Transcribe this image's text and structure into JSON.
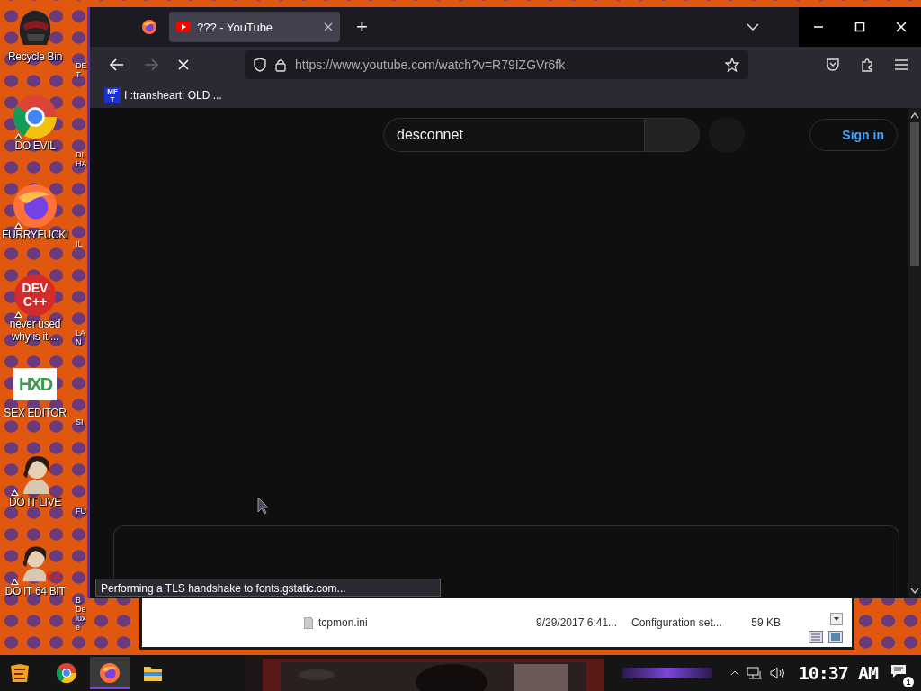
{
  "desktop_icons": [
    {
      "kind": "bin",
      "label": "Recycle Bin",
      "shortcut": false
    },
    {
      "kind": "chrome",
      "label": "DO EVIL",
      "shortcut": true
    },
    {
      "kind": "firefox",
      "label": "FURRYFUCK!",
      "shortcut": true
    },
    {
      "kind": "devcpp",
      "label": "never used why is it ...",
      "icon_text": "DEV C++",
      "shortcut": true
    },
    {
      "kind": "hxd",
      "label": "SEX EDITOR",
      "icon_text": "HXD",
      "shortcut": false
    },
    {
      "kind": "portrait",
      "label": "DO IT LIVE",
      "shortcut": true
    },
    {
      "kind": "portrait",
      "label": "DO IT 64 BIT",
      "icon_text": "64",
      "shortcut": true
    }
  ],
  "desktop_icons_column_2": [
    "DET",
    "DI HA",
    "IL",
    "LAN",
    "SI",
    "FU",
    "B Deluxe"
  ],
  "explorer": {
    "rows": [
      {
        "name": "tcpmon.ini",
        "date": "9/29/2017 6:41...",
        "type": "Configuration set...",
        "size": "59 KB"
      }
    ]
  },
  "browser": {
    "tabs": [
      {
        "title": "??? - YouTube",
        "selected": true
      }
    ],
    "new_tab": "+",
    "url": "https://www.youtube.com/watch?v=R79IZGVr6fk",
    "forward_disabled": true,
    "loading": true,
    "bookmarks": [
      {
        "icon_text": "MF T",
        "label": "I :transheart: OLD ..."
      }
    ],
    "page": {
      "search": {
        "value": "desconnet"
      },
      "sign_in": "Sign in"
    },
    "status": "Performing a TLS handshake to fonts.gstatic.com..."
  },
  "taskbar": {
    "apps": [
      {
        "kind": "start"
      },
      {
        "kind": "chrome",
        "selected": false
      },
      {
        "kind": "firefox",
        "selected": true
      },
      {
        "kind": "folder",
        "selected": false
      }
    ],
    "time": "10:37 AM",
    "notifications": "1"
  }
}
